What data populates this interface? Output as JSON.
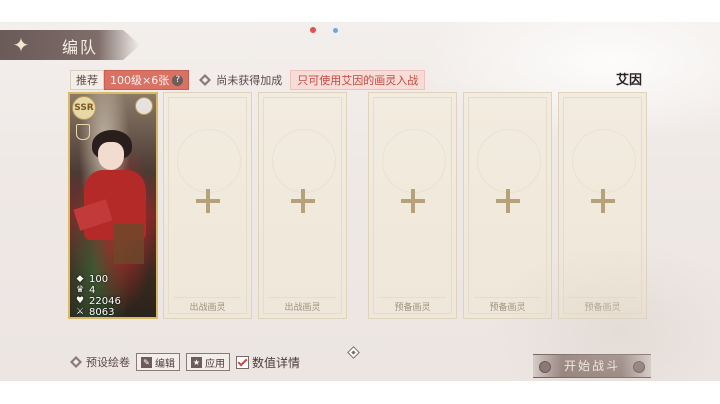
{
  "header": {
    "title": "编队"
  },
  "info": {
    "recommend_label": "推荐",
    "recommend_value": "100级×6张",
    "help_mark": "?",
    "bonus_text": "尚未获得加成",
    "restriction": "只可使用艾因的画灵入战",
    "character": "艾因"
  },
  "card": {
    "rarity": "SSR",
    "level": "100",
    "stars": "4",
    "hp": "22046",
    "attack": "8063"
  },
  "slots": [
    {
      "label": "出战画灵"
    },
    {
      "label": "出战画灵"
    },
    {
      "label": "预备画灵"
    },
    {
      "label": "预备画灵"
    },
    {
      "label": "预备画灵"
    }
  ],
  "bottom": {
    "preset_label": "预设绘卷",
    "edit_label": "编辑",
    "apply_label": "应用",
    "details_label": "数值详情",
    "details_checked": true
  },
  "start_button": "开始战斗",
  "colors": {
    "accent_red": "#d97264",
    "frame_gold": "#d9b866",
    "header_brown": "#6a5a58"
  }
}
